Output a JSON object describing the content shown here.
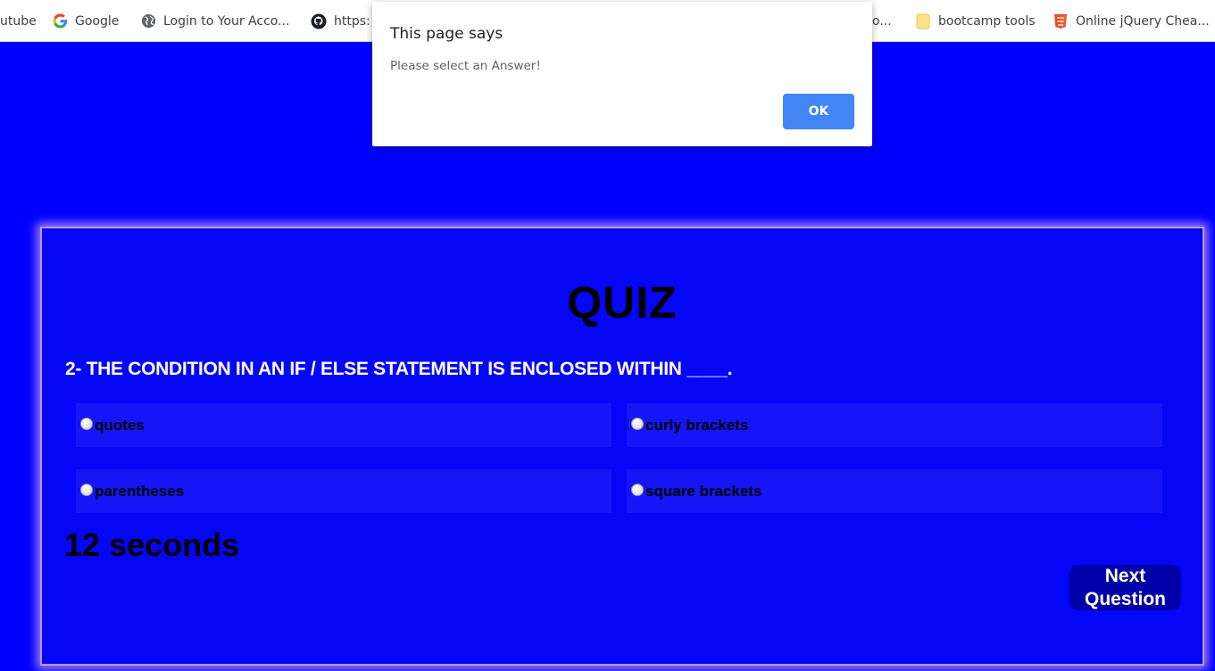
{
  "bookmarks": [
    {
      "label": "utube",
      "icon": "youtube-icon"
    },
    {
      "label": "Google",
      "icon": "google-icon"
    },
    {
      "label": "Login to Your Acco...",
      "icon": "globe-icon"
    },
    {
      "label": "https:",
      "icon": "github-icon"
    },
    {
      "label": "o...",
      "icon": "none"
    },
    {
      "label": "bootcamp tools",
      "icon": "folder-icon"
    },
    {
      "label": "Online jQuery Chea...",
      "icon": "html5-icon"
    }
  ],
  "dialog": {
    "title": "This page says",
    "message": "Please select an Answer!",
    "ok_label": "OK"
  },
  "quiz": {
    "title": "QUIZ",
    "question": "2- THE CONDITION IN AN IF / ELSE STATEMENT IS ENCLOSED WITHIN ____.",
    "answers": [
      {
        "label": "quotes"
      },
      {
        "label": "curly brackets"
      },
      {
        "label": "parentheses"
      },
      {
        "label": "square brackets"
      }
    ],
    "timer": "12 seconds",
    "next_label": "Next Question"
  },
  "colors": {
    "background": "#0000ff",
    "card": "#0505f8",
    "answer_bg": "#1515f7",
    "next_button": "#0000a8",
    "dialog_ok": "#4285f4"
  }
}
